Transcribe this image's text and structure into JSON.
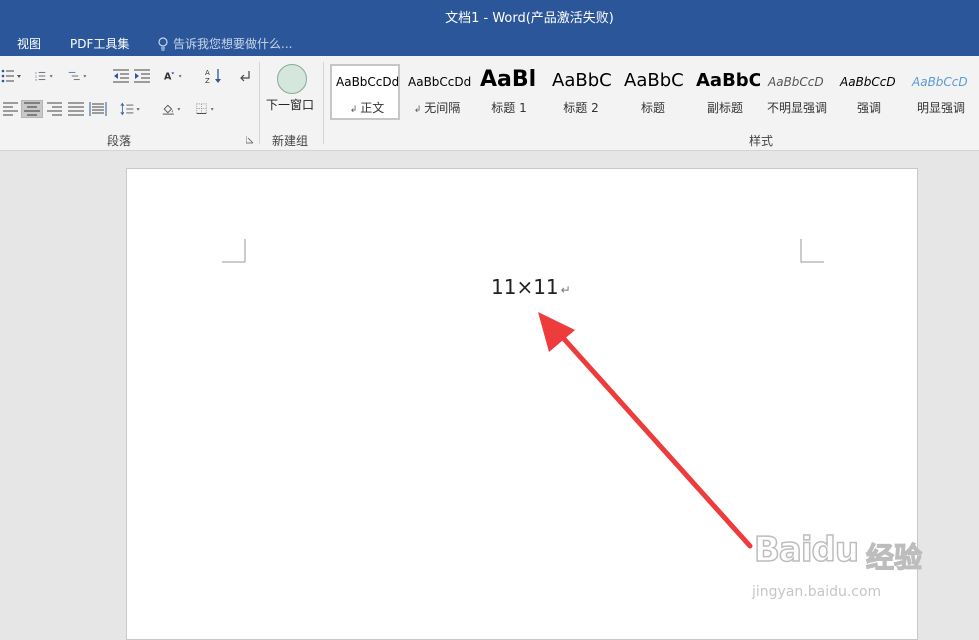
{
  "window": {
    "title": "文档1 - Word(产品激活失败)"
  },
  "menu": {
    "tabs": [
      "视图",
      "PDF工具集"
    ],
    "tell_me_placeholder": "告诉我您想要做什么..."
  },
  "ribbon": {
    "paragraph_group_label": "段落",
    "new_window_label": "下一窗口",
    "new_group_label": "新建组",
    "styles_group_label": "样式",
    "styles": [
      {
        "sample": "AaBbCcDd",
        "name": "正文",
        "has_mark": true
      },
      {
        "sample": "AaBbCcDd",
        "name": "无间隔",
        "has_mark": true
      },
      {
        "sample": "AaBl",
        "name": "标题 1"
      },
      {
        "sample": "AaBbC",
        "name": "标题 2"
      },
      {
        "sample": "AaBbC",
        "name": "标题"
      },
      {
        "sample": "AaBbC",
        "name": "副标题"
      },
      {
        "sample": "AaBbCcD",
        "name": "不明显强调"
      },
      {
        "sample": "AaBbCcD",
        "name": "强调"
      },
      {
        "sample": "AaBbCcD",
        "name": "明显强调"
      }
    ]
  },
  "document": {
    "text": "11×11",
    "paragraph_mark": "↵"
  },
  "watermark": {
    "logo": "Baidu",
    "brand_cn": "经验",
    "url": "jingyan.baidu.com"
  },
  "colors": {
    "title_bar": "#2b579a",
    "arrow": "#ee3b3b"
  }
}
